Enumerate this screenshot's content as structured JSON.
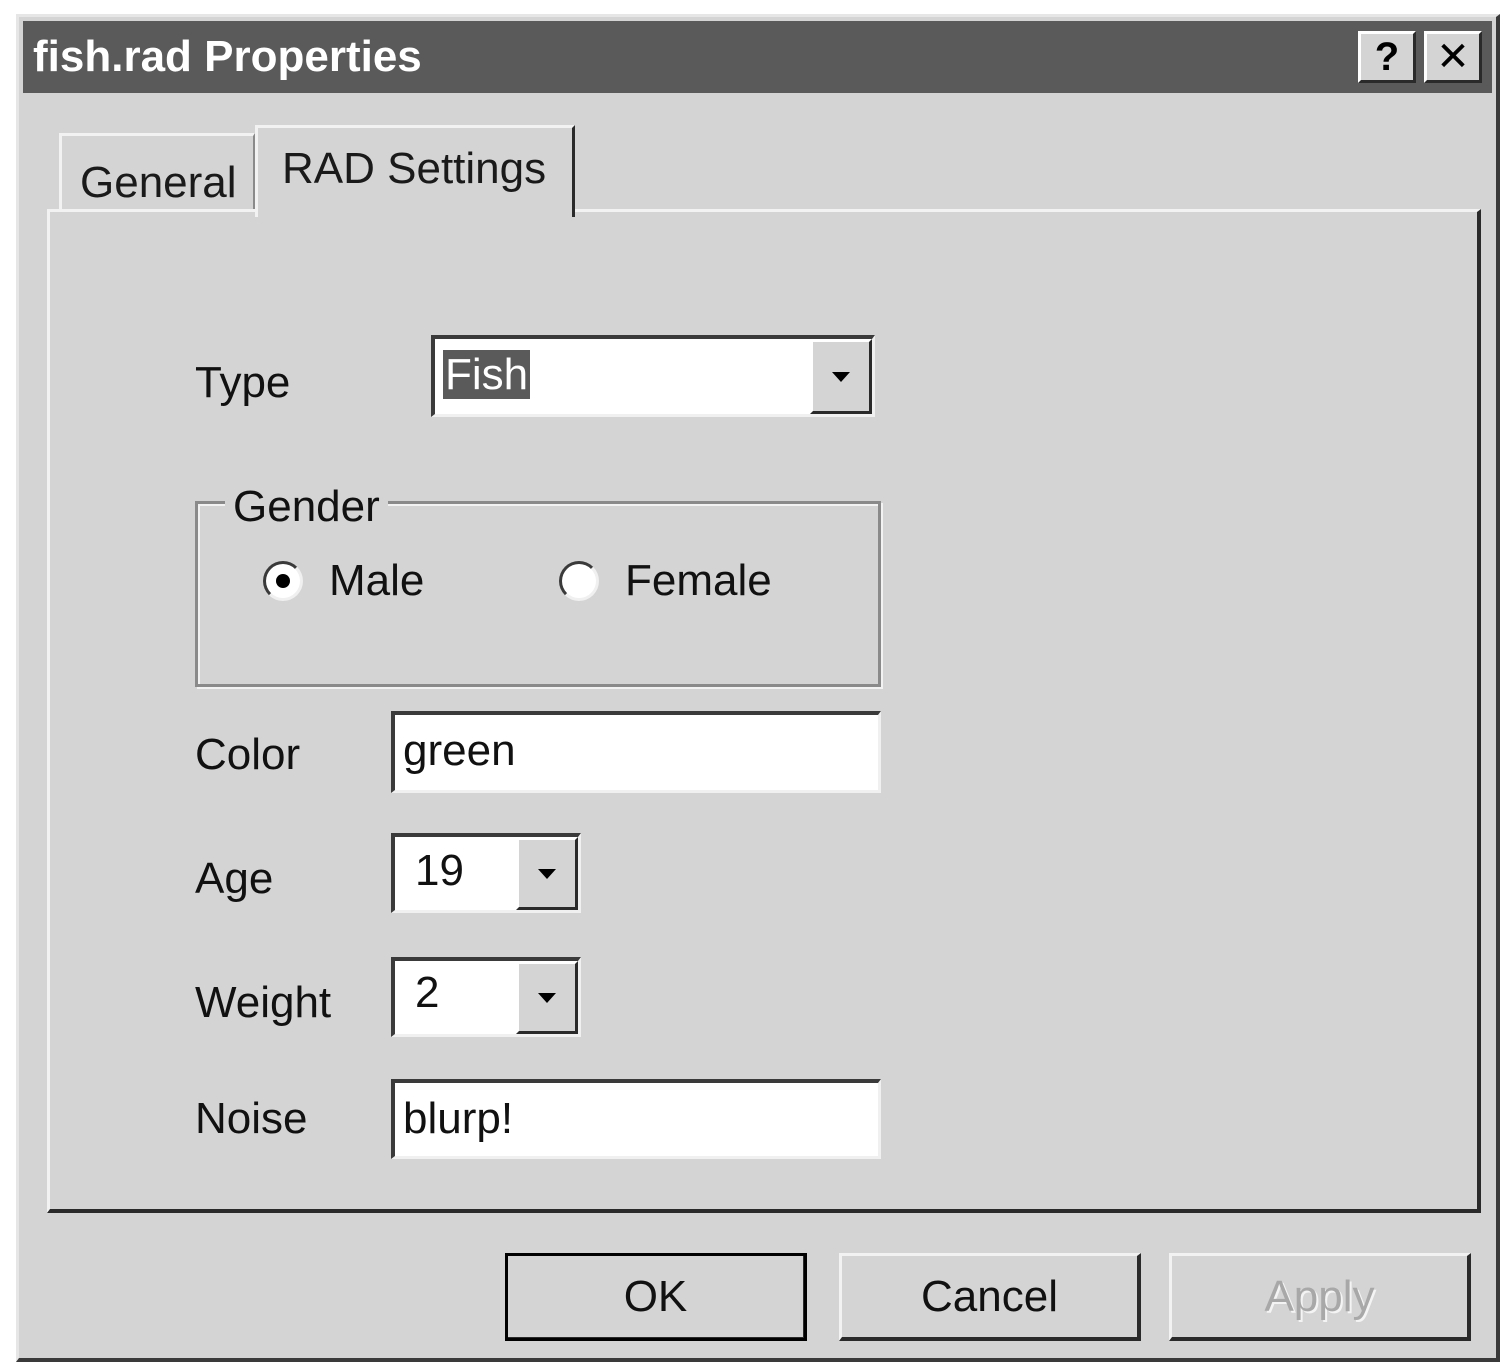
{
  "window": {
    "title": "fish.rad Properties",
    "help_label": "?",
    "close_label": "✕"
  },
  "tabs": [
    {
      "label": "General",
      "active": false
    },
    {
      "label": "RAD Settings",
      "active": true
    }
  ],
  "form": {
    "type": {
      "label": "Type",
      "value": "Fish"
    },
    "gender": {
      "legend": "Gender",
      "options": [
        {
          "label": "Male",
          "selected": true
        },
        {
          "label": "Female",
          "selected": false
        }
      ]
    },
    "color": {
      "label": "Color",
      "value": "green"
    },
    "age": {
      "label": "Age",
      "value": "19"
    },
    "weight": {
      "label": "Weight",
      "value": "2"
    },
    "noise": {
      "label": "Noise",
      "value": "blurp!"
    }
  },
  "buttons": {
    "ok": "OK",
    "cancel": "Cancel",
    "apply": "Apply"
  },
  "icons": {
    "help": "help-icon",
    "close": "close-icon",
    "dropdown": "chevron-down-icon"
  }
}
